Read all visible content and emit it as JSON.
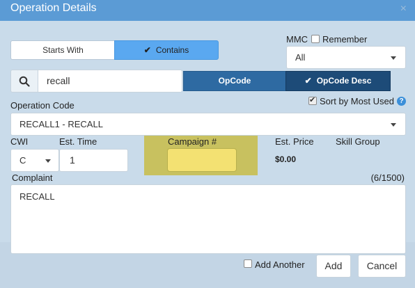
{
  "dialog": {
    "title": "Operation Details",
    "close": "×"
  },
  "match_mode": {
    "starts_with": "Starts With",
    "contains": "Contains",
    "selected": "Contains"
  },
  "mmc": {
    "label": "MMC",
    "remember_label": "Remember",
    "remember_checked": false,
    "value": "All"
  },
  "search": {
    "value": "recall",
    "icon": "search-icon"
  },
  "search_by": {
    "opcode_label": "OpCode",
    "opcode_desc_label": "OpCode Desc",
    "selected": "OpCode Desc"
  },
  "operation_code": {
    "label": "Operation Code",
    "value": "RECALL1 - RECALL",
    "sort_label": "Sort by Most Used",
    "sort_checked": true
  },
  "fields": {
    "cwi_label": "CWI",
    "cwi_value": "C",
    "est_time_label": "Est. Time",
    "est_time_value": "1",
    "campaign_label": "Campaign #",
    "campaign_value": "",
    "est_price_label": "Est. Price",
    "est_price_value": "$0.00",
    "skill_group_label": "Skill Group"
  },
  "complaint": {
    "label": "Complaint",
    "counter": "(6/1500)",
    "value": "RECALL"
  },
  "footer": {
    "add_another_label": "Add Another",
    "add_another_checked": false,
    "add_label": "Add",
    "cancel_label": "Cancel"
  },
  "colors": {
    "titlebar": "#5b9bd5",
    "body": "#c9dbea",
    "selected_toggle": "#5aa8f0",
    "opcode_button": "#2e6aa2",
    "opcode_desc_button": "#1d4b78",
    "campaign_highlight": "#c8c15f",
    "campaign_field": "#f3e172"
  }
}
